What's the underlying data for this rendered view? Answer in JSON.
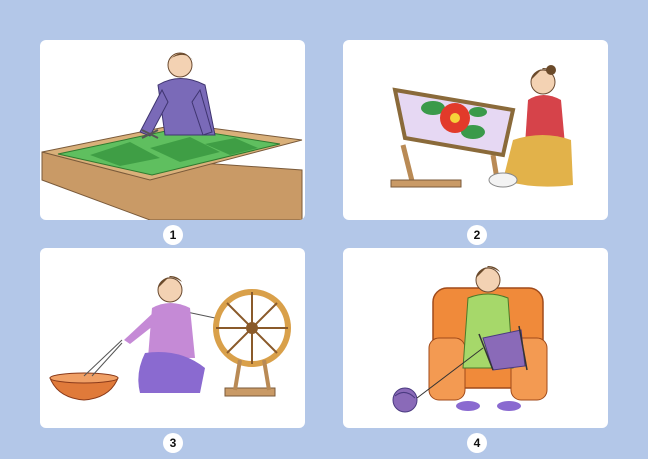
{
  "panels": [
    {
      "number": "1",
      "illustration": "man-cutting-green-fabric-on-table"
    },
    {
      "number": "2",
      "illustration": "woman-embroidering-red-flower-on-frame"
    },
    {
      "number": "3",
      "illustration": "woman-spinning-thread-on-wheel"
    },
    {
      "number": "4",
      "illustration": "woman-knitting-in-armchair"
    }
  ]
}
